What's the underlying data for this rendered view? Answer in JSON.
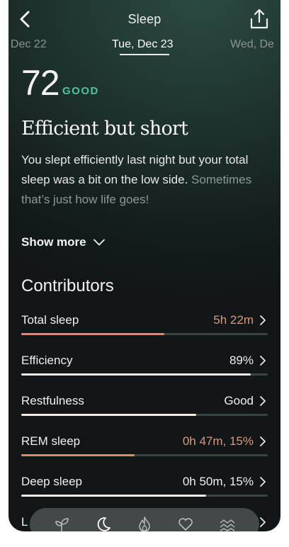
{
  "header": {
    "title": "Sleep",
    "back_icon": "chevron-left-icon",
    "share_icon": "share-icon"
  },
  "dates": {
    "prev": ", Dec 22",
    "current": "Tue, Dec 23",
    "next": "Wed, De"
  },
  "score": {
    "value": "72",
    "label": "GOOD",
    "label_color": "#4fc3a0"
  },
  "summary": {
    "headline": "Efficient but short",
    "text": "You slept efficiently last night but your total sleep was a bit on the low side.",
    "text_faded": "Sometimes that’s just how life goes!",
    "show_more": "Show more"
  },
  "contributors": {
    "title": "Contributors",
    "items": [
      {
        "label": "Total sleep",
        "value": "5h 22m",
        "level": 0.58,
        "warn": true
      },
      {
        "label": "Efficiency",
        "value": "89%",
        "level": 0.93,
        "warn": false
      },
      {
        "label": "Restfulness",
        "value": "Good",
        "level": 0.71,
        "warn": false
      },
      {
        "label": "REM sleep",
        "value": "0h 47m, 15%",
        "level": 0.46,
        "warn": true
      },
      {
        "label": "Deep sleep",
        "value": "0h 50m, 15%",
        "level": 0.75,
        "warn": false
      },
      {
        "label": "L",
        "value": "",
        "level": 0,
        "warn": false
      }
    ]
  },
  "colors": {
    "warn": "#d98a72",
    "accent": "#4fc3a0"
  },
  "bottom_nav": {
    "items": [
      "sprout-icon",
      "moon-icon",
      "flame-icon",
      "heart-icon",
      "waves-icon"
    ],
    "active": "moon-icon"
  }
}
